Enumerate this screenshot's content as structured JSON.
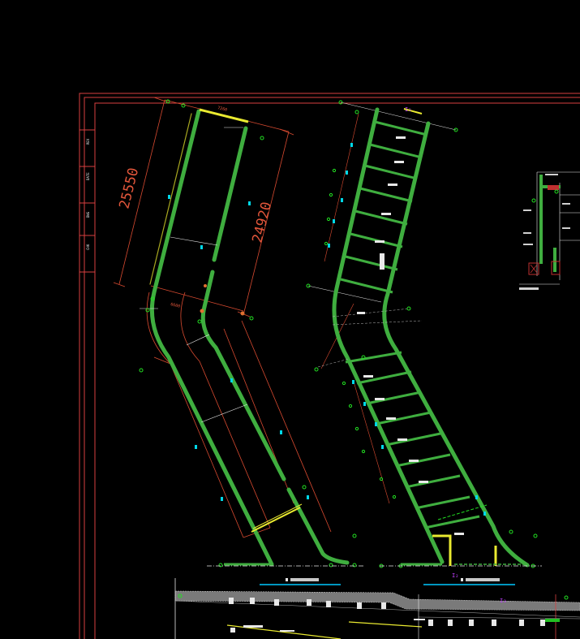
{
  "drawing": {
    "dimensions": {
      "left_long": "25550",
      "right_long": "24920",
      "top_width": "7260",
      "mid_width": "6600"
    },
    "section_marks": {
      "i1": "I₁",
      "i2": "I₂",
      "i3": "I₃"
    },
    "colors": {
      "background": "#000000",
      "frame": "#d84040",
      "wall": "#3fae3f",
      "dimension": "#d84a30",
      "node": "#22e022",
      "highlight": "#ffff33",
      "caption_line": "#00c8ff",
      "section_mark": "#c040ff"
    }
  }
}
